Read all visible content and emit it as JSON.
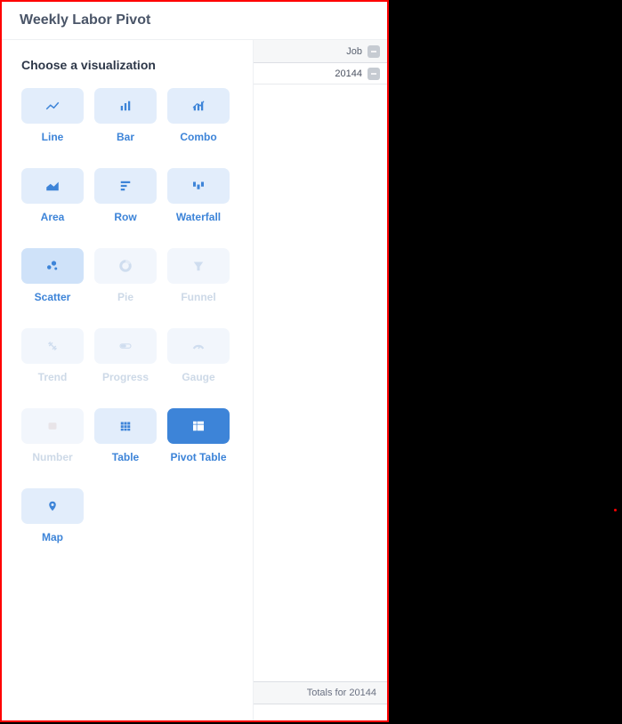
{
  "header": {
    "title": "Weekly Labor Pivot"
  },
  "viz_section": {
    "title": "Choose a visualization"
  },
  "viz": {
    "line": {
      "label": "Line",
      "enabled": true,
      "selected": false
    },
    "bar": {
      "label": "Bar",
      "enabled": true,
      "selected": false
    },
    "combo": {
      "label": "Combo",
      "enabled": true,
      "selected": false
    },
    "area": {
      "label": "Area",
      "enabled": true,
      "selected": false
    },
    "row": {
      "label": "Row",
      "enabled": true,
      "selected": false
    },
    "waterfall": {
      "label": "Waterfall",
      "enabled": true,
      "selected": false
    },
    "scatter": {
      "label": "Scatter",
      "enabled": true,
      "selected": false
    },
    "pie": {
      "label": "Pie",
      "enabled": false,
      "selected": false
    },
    "funnel": {
      "label": "Funnel",
      "enabled": false,
      "selected": false
    },
    "trend": {
      "label": "Trend",
      "enabled": false,
      "selected": false
    },
    "progress": {
      "label": "Progress",
      "enabled": false,
      "selected": false
    },
    "gauge": {
      "label": "Gauge",
      "enabled": false,
      "selected": false
    },
    "number": {
      "label": "Number",
      "enabled": false,
      "selected": false
    },
    "table": {
      "label": "Table",
      "enabled": true,
      "selected": false
    },
    "pivot": {
      "label": "Pivot Table",
      "enabled": true,
      "selected": true
    },
    "map": {
      "label": "Map",
      "enabled": true,
      "selected": false
    }
  },
  "pivot": {
    "column_header": "Job",
    "rows": [
      {
        "value": "20144"
      }
    ],
    "totals_label": "Totals for 20144"
  }
}
